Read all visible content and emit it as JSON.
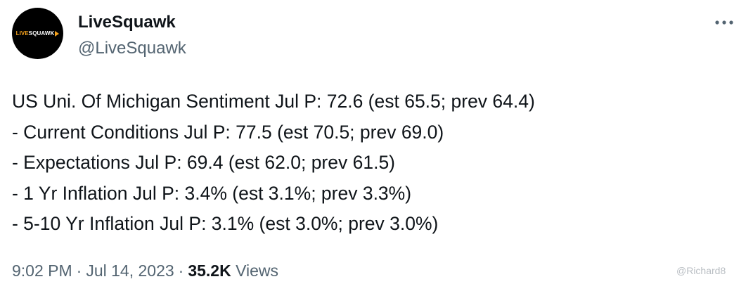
{
  "author": {
    "display_name": "LiveSquawk",
    "handle": "@LiveSquawk",
    "avatar_logo": {
      "part1": "LIVE",
      "part2": "SQUAWK",
      "accent_color": "#f6a21c"
    }
  },
  "more_icon": "more-horizontal-icon",
  "tweet": {
    "lines": [
      "US Uni. Of Michigan Sentiment Jul P: 72.6 (est 65.5; prev 64.4)",
      "- Current Conditions Jul P: 77.5 (est 70.5; prev 69.0)",
      "- Expectations Jul P: 69.4 (est 62.0; prev 61.5)",
      "- 1 Yr Inflation Jul P: 3.4% (est 3.1%; prev 3.3%)",
      "- 5-10 Yr Inflation Jul P: 3.1% (est 3.0%; prev 3.0%)"
    ]
  },
  "meta": {
    "time": "9:02 PM",
    "separator": "·",
    "date": "Jul 14, 2023",
    "views_count": "35.2K",
    "views_label": "Views"
  },
  "watermark": {
    "text": "@Richard8"
  },
  "colors": {
    "primary_text": "#0f1419",
    "secondary_text": "#536471"
  }
}
